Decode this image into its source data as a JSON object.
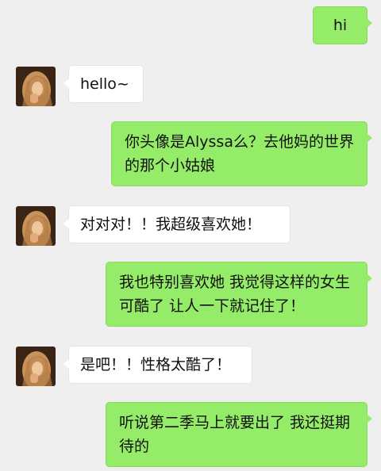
{
  "colors": {
    "background": "#efefef",
    "outgoing_bubble": "#95ec69",
    "incoming_bubble": "#ffffff"
  },
  "contact": {
    "avatar_icon": "contact-avatar-photo"
  },
  "messages": [
    {
      "side": "out",
      "text": "hi"
    },
    {
      "side": "in",
      "text": "hello~"
    },
    {
      "side": "out",
      "text": "你头像是Alyssa么？去他妈的世界的那个小姑娘"
    },
    {
      "side": "in",
      "text": "对对对！！我超级喜欢她！"
    },
    {
      "side": "out",
      "text": "我也特别喜欢她 我觉得这样的女生可酷了 让人一下就记住了！"
    },
    {
      "side": "in",
      "text": "是吧！！性格太酷了！"
    },
    {
      "side": "out",
      "text": "听说第二季马上就要出了 我还挺期待的"
    }
  ]
}
